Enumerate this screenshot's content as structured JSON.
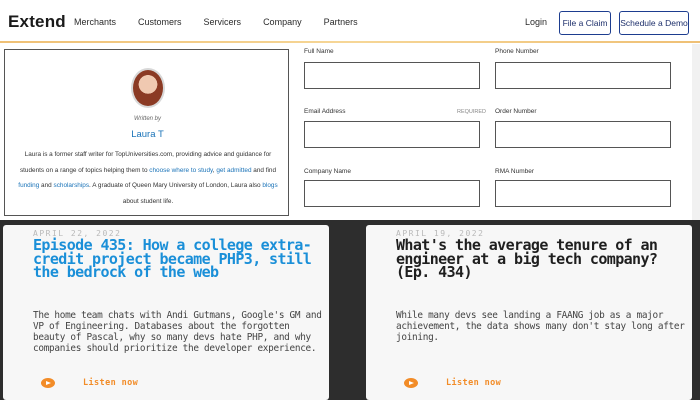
{
  "nav": {
    "brand": "Extend",
    "links": [
      "Merchants",
      "Customers",
      "Servicers",
      "Company",
      "Partners"
    ],
    "login": "Login",
    "file_claim": "File a Claim",
    "schedule_demo": "Schedule a Demo"
  },
  "author": {
    "written_by": "Written by",
    "name": "Laura T",
    "bio_1": "Laura is a former staff writer for TopUniversities.com, providing advice and guidance for students on a range of topics helping them to",
    "bio_link_1": "choose where to study",
    "bio_2": ",",
    "bio_link_2": "get admitted",
    "bio_3": "and find",
    "bio_link_3": "funding",
    "bio_4": "and",
    "bio_link_4": "scholarships",
    "bio_5": ". A graduate of Queen Mary University of London, Laura also",
    "bio_link_5": "blogs",
    "bio_6": "about student life."
  },
  "form": {
    "full_name": "Full Name",
    "phone_number": "Phone Number",
    "email_address": "Email Address",
    "required": "REQUIRED",
    "order_number": "Order Number",
    "company_name": "Company Name",
    "rma_number": "RMA Number"
  },
  "podcasts": [
    {
      "date": "APRIL 22, 2022",
      "title": "Episode 435: How a college extra-credit project became PHP3, still the bedrock of the web",
      "description": "The home team chats with Andi Gutmans, Google's GM and VP of Engineering. Databases about the forgotten beauty of Pascal, why so many devs hate PHP, and why companies should prioritize the developer experience.",
      "listen": "Listen now",
      "title_color": "#1a8fd8"
    },
    {
      "date": "APRIL 19, 2022",
      "title": "What's the average tenure of an engineer at a big tech company? (Ep. 434)",
      "description": "While many devs see landing a FAANG job as a major achievement, the data shows many don't stay long after joining.",
      "listen": "Listen now",
      "title_color": "#1f1f1f"
    }
  ],
  "colors": {
    "accent_orange": "#f28c28",
    "link_blue": "#1a73b8",
    "button_border": "#1d3d8f",
    "dark_band": "#2d2d2d"
  },
  "icons": [
    "play-icon"
  ]
}
